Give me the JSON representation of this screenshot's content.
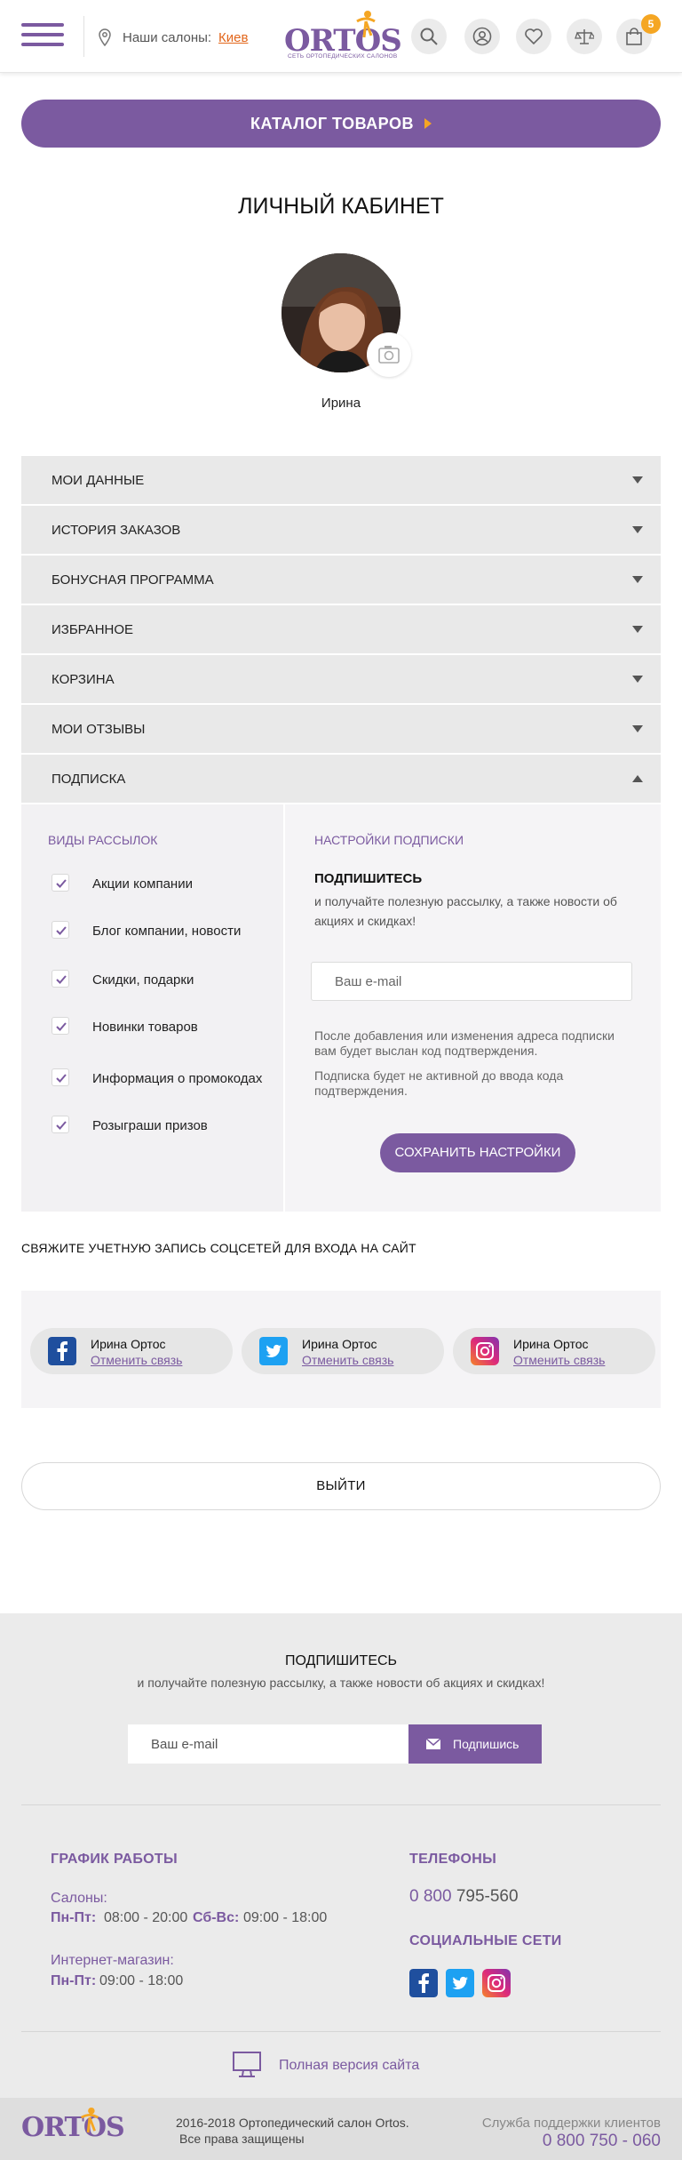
{
  "header": {
    "salons_label": "Наши салоны:",
    "city": "Киев",
    "logo_text": "ORTOS",
    "logo_sub": "СЕТЬ ОРТОПЕДИЧЕСКИХ САЛОНОВ",
    "cart_count": "5"
  },
  "catalog": {
    "label": "КАТАЛОГ ТОВАРОВ"
  },
  "page_title": "ЛИЧНЫЙ КАБИНЕТ",
  "user": {
    "name": "Ирина"
  },
  "accordion": [
    {
      "label": "МОИ ДАННЫЕ",
      "open": false
    },
    {
      "label": "ИСТОРИЯ ЗАКАЗОВ",
      "open": false
    },
    {
      "label": "БОНУСНАЯ ПРОГРАММА",
      "open": false
    },
    {
      "label": "ИЗБРАННОЕ",
      "open": false
    },
    {
      "label": "КОРЗИНА",
      "open": false
    },
    {
      "label": "МОИ ОТЗЫВЫ",
      "open": false
    },
    {
      "label": "ПОДПИСКА",
      "open": true
    }
  ],
  "subscription": {
    "types_title": "ВИДЫ РАССЫЛОК",
    "types": [
      {
        "label": "Акции компании",
        "checked": true
      },
      {
        "label": "Блог компании, новости",
        "checked": true
      },
      {
        "label": "Скидки, подарки",
        "checked": true
      },
      {
        "label": "Новинки товаров",
        "checked": true
      },
      {
        "label": "Информация о промокодах",
        "checked": true
      },
      {
        "label": "Розыграши призов",
        "checked": true
      }
    ],
    "settings_title": "НАСТРОЙКИ ПОДПИСКИ",
    "subscribe_title": "ПОДПИШИТЕСЬ",
    "subscribe_desc": "и получайте полезную рассылку, а также новости об акциях и скидках!",
    "email_placeholder": "Ваш e-mail",
    "note1": "После добавления или изменения адреса подписки вам будет выслан код подтверждения.",
    "note2": "Подписка будет не активной до ввода кода подтверждения.",
    "save_label": "СОХРАНИТЬ НАСТРОЙКИ"
  },
  "social_link": {
    "title": "СВЯЖИТЕ УЧЕТНУЮ ЗАПИСЬ СОЦСЕТЕЙ ДЛЯ ВХОДА НА САЙТ",
    "accounts": [
      {
        "network": "facebook",
        "name": "Ирина Ортос",
        "action": "Отменить связь"
      },
      {
        "network": "twitter",
        "name": "Ирина Ортос",
        "action": "Отменить связь"
      },
      {
        "network": "instagram",
        "name": "Ирина Ортос",
        "action": "Отменить связь"
      }
    ]
  },
  "logout_label": "ВЫЙТИ",
  "footer": {
    "subscribe_title": "ПОДПИШИТЕСЬ",
    "subscribe_desc": "и получайте полезную рассылку, а также новости об акциях и скидках!",
    "email_placeholder": "Ваш e-mail",
    "subscribe_btn": "Подпишись",
    "schedule_title": "ГРАФИК РАБОТЫ",
    "salons_label": "Салоны:",
    "weekdays_label": "Пн-Пт:",
    "weekdays_hours": "08:00 - 20:00",
    "weekend_label": "Сб-Вс:",
    "weekend_hours": "09:00 - 18:00",
    "shop_label": "Интернет-магазин:",
    "shop_days_label": "Пн-Пт:",
    "shop_hours": "09:00 - 18:00",
    "phones_title": "ТЕЛЕФОНЫ",
    "phone_prefix": "0 800",
    "phone_rest": "795-560",
    "social_title": "СОЦИАЛЬНЫЕ СЕТИ",
    "full_version": "Полная версия сайта"
  },
  "bottom": {
    "logo_text": "ORTOS",
    "copy1": "2016-2018  Ортопедический салон Ortos.",
    "copy2": "Все права защищены",
    "support_label": "Служба поддержки клиентов",
    "support_phone": "0 800 750 - 060"
  },
  "colors": {
    "brand": "#7b5aa0",
    "accent": "#f5a623",
    "city_link": "#e2661b",
    "facebook": "#1f4f9e",
    "twitter": "#1da1f2",
    "instagram": "#c13584"
  }
}
